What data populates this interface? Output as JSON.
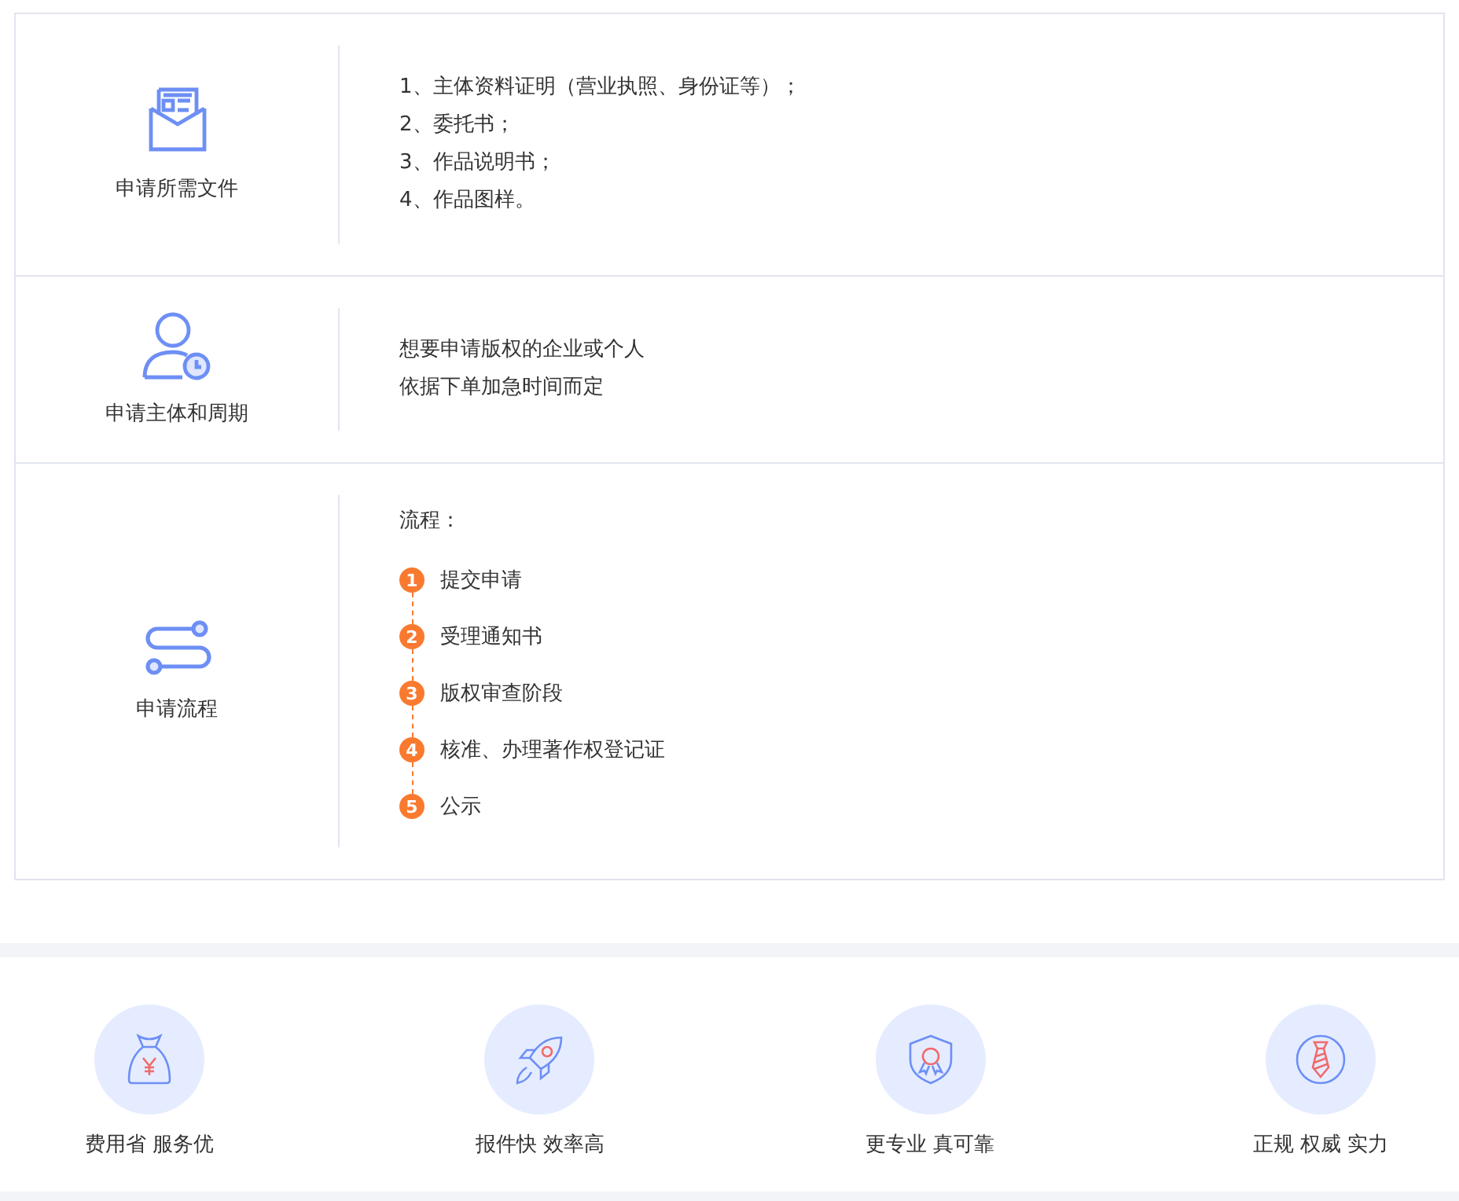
{
  "sections": [
    {
      "kind": "list",
      "title": "申请所需文件",
      "lines": [
        "1、主体资料证明（营业执照、身份证等）；",
        "2、委托书；",
        "3、作品说明书；",
        "4、作品图样。"
      ]
    },
    {
      "kind": "text",
      "title": "申请主体和周期",
      "lines": [
        "想要申请版权的企业或个人",
        "依据下单加急时间而定"
      ]
    },
    {
      "kind": "steps",
      "title": "申请流程",
      "heading": "流程：",
      "steps": [
        {
          "number": "1",
          "label": "提交申请"
        },
        {
          "number": "2",
          "label": "受理通知书"
        },
        {
          "number": "3",
          "label": "版权审查阶段"
        },
        {
          "number": "4",
          "label": "核准、办理著作权登记证"
        },
        {
          "number": "5",
          "label": "公示"
        }
      ]
    }
  ],
  "features": [
    {
      "label": "费用省 服务优"
    },
    {
      "label": "报件快 效率高"
    },
    {
      "label": "更专业 真可靠"
    },
    {
      "label": "正规 权威 实力"
    }
  ]
}
